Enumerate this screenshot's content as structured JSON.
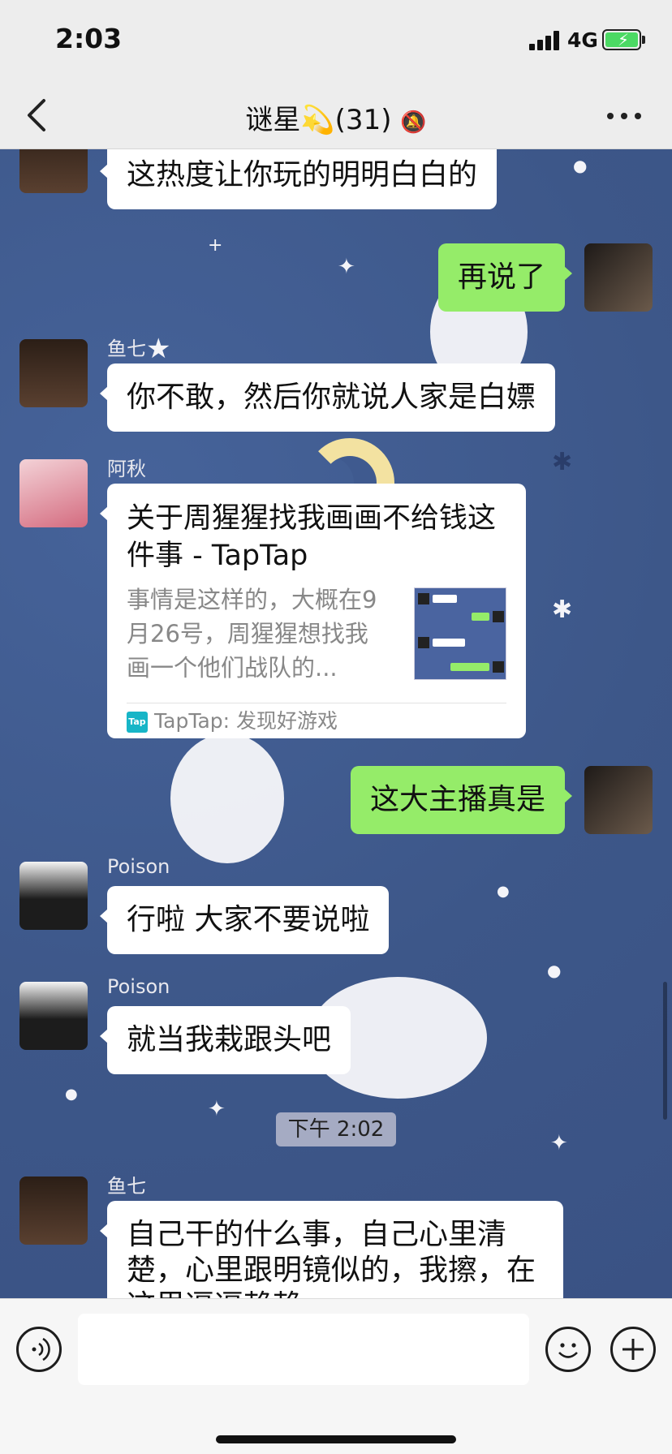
{
  "status_bar": {
    "time": "2:03",
    "network": "4G"
  },
  "nav": {
    "title": "谜星",
    "title_emoji": "💫",
    "member_count": "(31)",
    "mute_icon": "bell-slash-icon"
  },
  "messages": [
    {
      "side": "left",
      "sender": "",
      "text": "这热度让你玩的明明白白的"
    },
    {
      "side": "right",
      "text": "再说了"
    },
    {
      "side": "left",
      "sender": "鱼七",
      "text": "你不敢，然后你就说人家是白嫖"
    },
    {
      "side": "left",
      "sender": "阿秋",
      "type": "link",
      "link": {
        "title": "关于周猩猩找我画画不给钱这件事 - TapTap",
        "desc": "事情是这样的，大概在9月26号，周猩猩想找我画一个他们战队的...",
        "source": "TapTap: 发现好游戏",
        "source_icon_text": "Tap"
      }
    },
    {
      "side": "right",
      "text": "这大主播真是"
    },
    {
      "side": "left",
      "sender": "Poison",
      "text": "行啦 大家不要说啦"
    },
    {
      "side": "left",
      "sender": "Poison",
      "text": "就当我栽跟头吧"
    },
    {
      "type": "time",
      "text": "下午 2:02"
    },
    {
      "side": "left",
      "sender": "鱼七",
      "text_lines": [
        "自己干的什么事，自己心里清",
        "楚，心里跟明镜似的，我擦，在",
        "这里逼逼赖赖"
      ]
    }
  ],
  "input": {
    "placeholder": ""
  },
  "colors": {
    "my_bubble": "#95ec69",
    "other_bubble": "#ffffff",
    "chat_bg": "#3f5a8f",
    "bar_bg": "#ededed"
  }
}
